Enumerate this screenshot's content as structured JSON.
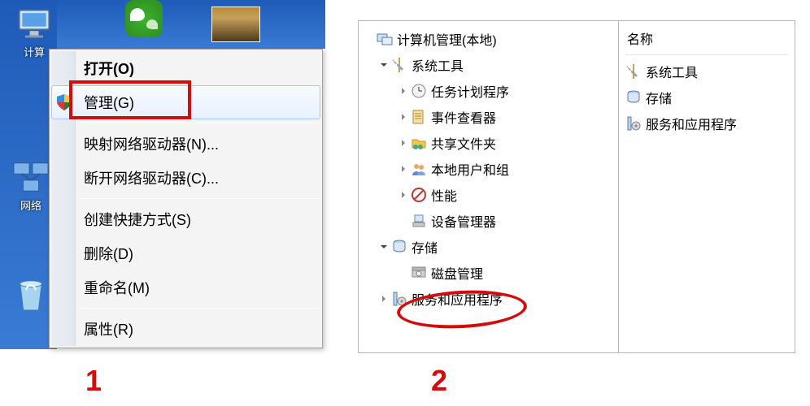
{
  "annotations": {
    "step1": "1",
    "step2": "2"
  },
  "desktop": {
    "computer_label": "计算",
    "network_label": "网络",
    "wechat_tooltip": "WeChat"
  },
  "context_menu": {
    "open": "打开(O)",
    "manage": "管理(G)",
    "map_drive": "映射网络驱动器(N)...",
    "disconnect_drive": "断开网络驱动器(C)...",
    "create_shortcut": "创建快捷方式(S)",
    "delete": "删除(D)",
    "rename": "重命名(M)",
    "properties": "属性(R)"
  },
  "mmc": {
    "root": "计算机管理(本地)",
    "system_tools": "系统工具",
    "task_scheduler": "任务计划程序",
    "event_viewer": "事件查看器",
    "shared_folders": "共享文件夹",
    "local_users": "本地用户和组",
    "performance": "性能",
    "device_manager": "设备管理器",
    "storage": "存储",
    "disk_management": "磁盘管理",
    "services_apps": "服务和应用程序",
    "list_header": "名称"
  },
  "icons": {
    "shield": "shield-icon",
    "computer": "computer-icon",
    "network": "network-icon",
    "recycle": "recycle-icon",
    "wechat": "wechat-icon",
    "expander_open": "chevron-down-icon",
    "expander_closed": "chevron-right-icon",
    "mmc_root": "mmc-root-icon",
    "tools": "wrench-icon",
    "clock": "clock-icon",
    "event": "event-icon",
    "shared": "shared-folder-icon",
    "users": "users-icon",
    "perf": "no-icon",
    "device": "device-icon",
    "storage": "storage-icon",
    "disk": "disk-icon",
    "services": "gear-column-icon"
  }
}
